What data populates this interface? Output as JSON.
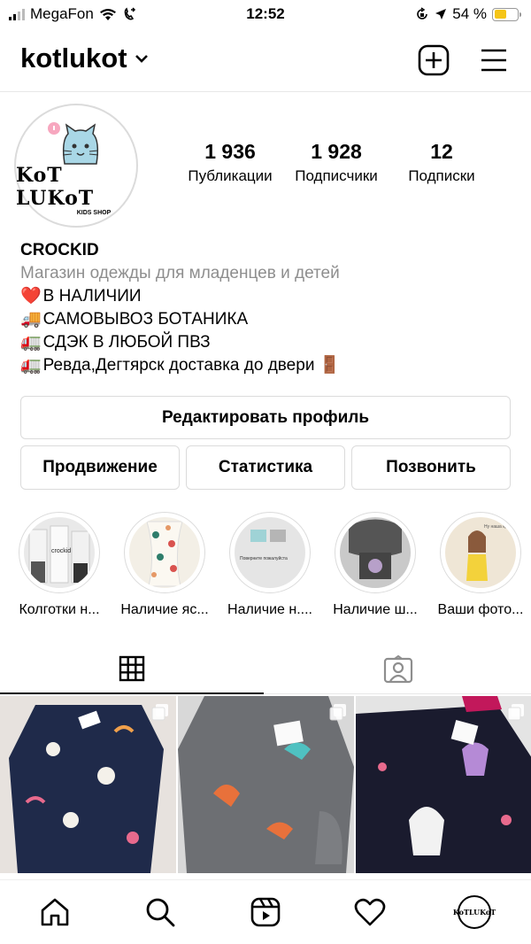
{
  "status_bar": {
    "carrier": "MegaFon",
    "time": "12:52",
    "battery_percent": "54 %",
    "battery_level": 0.54
  },
  "header": {
    "username": "kotlukot"
  },
  "profile": {
    "avatar_brand": "KoT LUKoT",
    "avatar_sub": "KIDS SHOP",
    "stats": [
      {
        "value": "1 936",
        "label": "Публикации"
      },
      {
        "value": "1 928",
        "label": "Подписчики"
      },
      {
        "value": "12",
        "label": "Подписки"
      }
    ],
    "name": "CROCKID",
    "category": "Магазин одежды для младенцев и детей",
    "bio_lines": [
      {
        "emoji": "❤️",
        "text": "В НАЛИЧИИ"
      },
      {
        "emoji": "🚚",
        "text": "САМОВЫВОЗ БОТАНИКА"
      },
      {
        "emoji": "🚛",
        "text": "СДЭК В ЛЮБОЙ ПВЗ"
      },
      {
        "emoji": "🚛",
        "text": "Ревда,Дегтярск доставка до двери 🚪"
      }
    ]
  },
  "buttons": {
    "edit_profile": "Редактировать профиль",
    "promotion": "Продвижение",
    "statistics": "Статистика",
    "call": "Позвонить"
  },
  "highlights": [
    {
      "label": "Колготки н..."
    },
    {
      "label": "Наличие яс..."
    },
    {
      "label": "Наличие н...."
    },
    {
      "label": "Наличие ш..."
    },
    {
      "label": "Ваши фото..."
    }
  ],
  "highlight_inner_texts": {
    "h1_brand": "crockid",
    "h3_text": "Поверните пожалуйста",
    "h5_text": "Ну наша кра"
  },
  "bottom_nav": {
    "avatar_text": "KoTLUKoT"
  }
}
